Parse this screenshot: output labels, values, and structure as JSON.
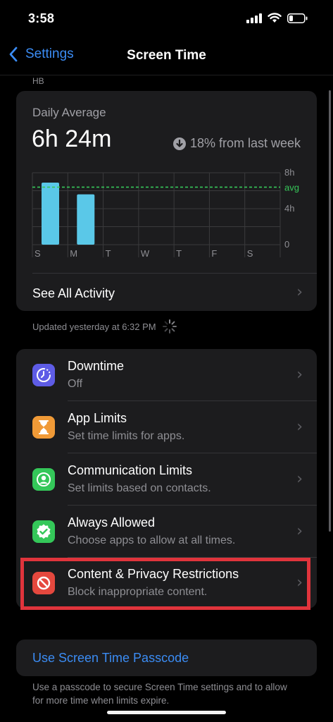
{
  "status": {
    "time": "3:58"
  },
  "nav": {
    "back_label": "Settings",
    "title": "Screen Time"
  },
  "account": "HB",
  "daily": {
    "label": "Daily Average",
    "value": "6h 24m",
    "trend": "18% from last week",
    "see_all": "See All Activity",
    "updated": "Updated yesterday at 6:32 PM"
  },
  "chart_data": {
    "type": "bar",
    "categories": [
      "S",
      "M",
      "T",
      "W",
      "T",
      "F",
      "S"
    ],
    "values": [
      6.9,
      5.6,
      0,
      0,
      0,
      0,
      0
    ],
    "y_ticks": [
      "8h",
      "4h",
      "0"
    ],
    "avg_label": "avg",
    "avg": 6.4,
    "ylim": [
      0,
      8
    ],
    "colors": {
      "bar": "#5ac8e8",
      "avg": "#37c759"
    }
  },
  "settings": {
    "rows": [
      {
        "title": "Downtime",
        "subtitle": "Off",
        "icon": "downtime-icon",
        "color": "#5e5ce6"
      },
      {
        "title": "App Limits",
        "subtitle": "Set time limits for apps.",
        "icon": "hourglass-icon",
        "color": "#f09a37"
      },
      {
        "title": "Communication Limits",
        "subtitle": "Set limits based on contacts.",
        "icon": "person-icon",
        "color": "#34c759"
      },
      {
        "title": "Always Allowed",
        "subtitle": "Choose apps to allow at all times.",
        "icon": "checkmark-badge-icon",
        "color": "#34c759"
      },
      {
        "title": "Content & Privacy Restrictions",
        "subtitle": "Block inappropriate content.",
        "icon": "restricted-icon",
        "color": "#e5483e"
      }
    ],
    "highlight_color": "#e0343c"
  },
  "passcode": {
    "label": "Use Screen Time Passcode",
    "footer": "Use a passcode to secure Screen Time settings and to allow for more time when limits expire."
  }
}
